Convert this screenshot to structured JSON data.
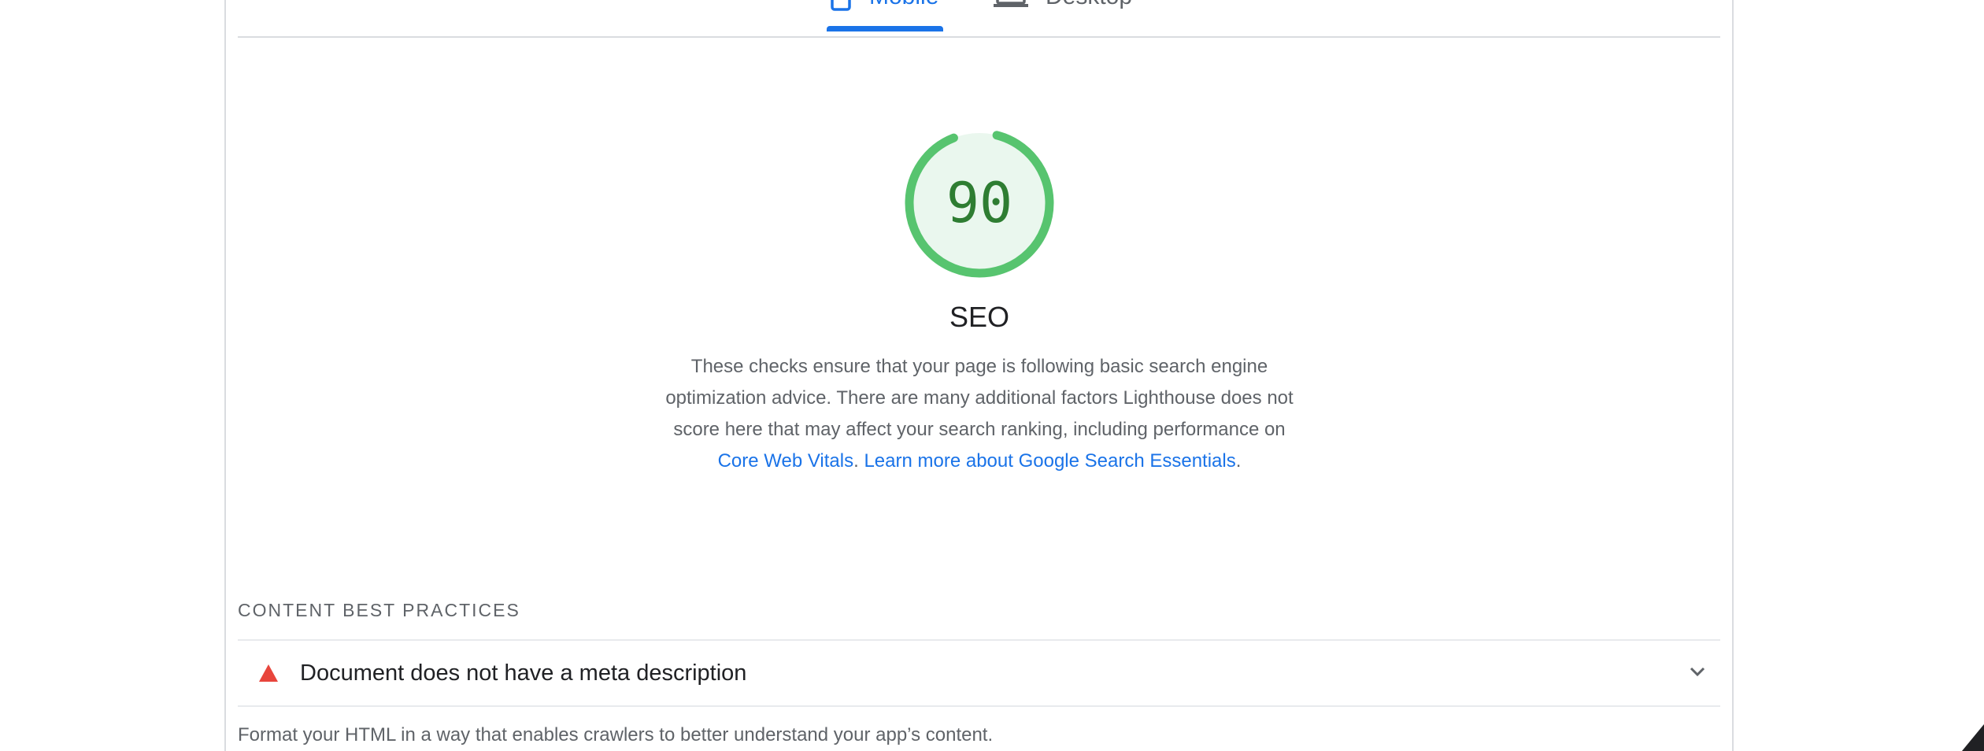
{
  "tabs": [
    {
      "label": "Mobile",
      "icon": "mobile-icon",
      "active": true
    },
    {
      "label": "Desktop",
      "icon": "desktop-icon",
      "active": false
    }
  ],
  "category": {
    "score": "90",
    "title": "SEO",
    "description_text": "These checks ensure that your page is following basic search engine optimization advice. There are many additional factors Lighthouse does not score here that may affect your search ranking, including performance on ",
    "link1": "Core Web Vitals",
    "link2": "Learn more about Google Search Essentials",
    "score_fraction": 0.9,
    "gauge_color": "#0cce6b",
    "score_text_color": "#2e7d32",
    "gauge_bg": "#eaf7ee"
  },
  "group": {
    "title": "CONTENT BEST PRACTICES",
    "audits": [
      {
        "title": "Document does not have a meta description",
        "status": "fail",
        "icon": "warning-triangle-icon",
        "color": "#e8453c"
      }
    ],
    "description": "Format your HTML in a way that enables crawlers to better understand your app’s content."
  }
}
